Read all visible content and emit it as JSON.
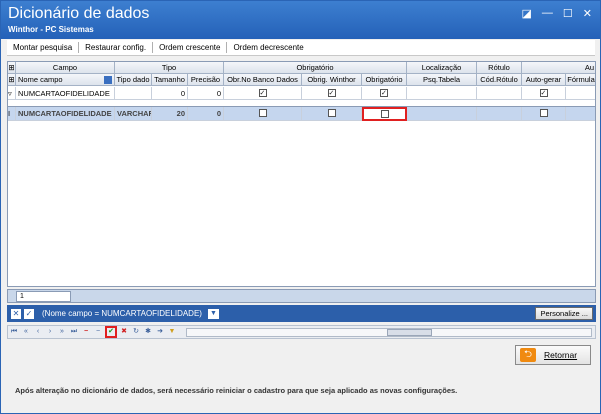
{
  "window": {
    "title": "Dicionário de dados",
    "subtitle": "Winthor - PC Sistemas"
  },
  "toolbar": {
    "items": [
      "Montar pesquisa",
      "Restaurar config.",
      "Ordem crescente",
      "Ordem decrescente"
    ]
  },
  "grid": {
    "band_headers": [
      "Campo",
      "Tipo",
      "Obrigatório",
      "Localização",
      "Rótulo",
      "Au"
    ],
    "column_headers": [
      "Nome campo",
      "Tipo dado",
      "Tamanho",
      "Precisão",
      "Obr.No Banco Dados",
      "Obrig. Winthor",
      "Obrigatório",
      "Psq.Tabela",
      "Cód.Rótulo",
      "Auto-gerar",
      "Fórmula"
    ],
    "filter_row": {
      "nome_campo": "NUMCARTAOFIDELIDADE",
      "tamanho": "0",
      "precisao": "0"
    },
    "rows": [
      {
        "nome_campo": "NUMCARTAOFIDELIDADE",
        "tipo_dado": "VARCHAR",
        "tamanho": "20",
        "precisao": "0"
      }
    ]
  },
  "pager": {
    "value": "1"
  },
  "filter": {
    "text": "(Nome campo = NUMCARTAOFIDELIDADE)",
    "personalize_label": "Personalize ..."
  },
  "buttons": {
    "return_label": "Retornar"
  },
  "footer": {
    "note": "Após alteração no dicionário de dados, será necessário reiniciar o cadastro para que seja aplicado as novas configurações."
  },
  "colors": {
    "titlebar": "#2461b8",
    "filterbar": "#2c5faa",
    "highlight": "#e02020"
  }
}
